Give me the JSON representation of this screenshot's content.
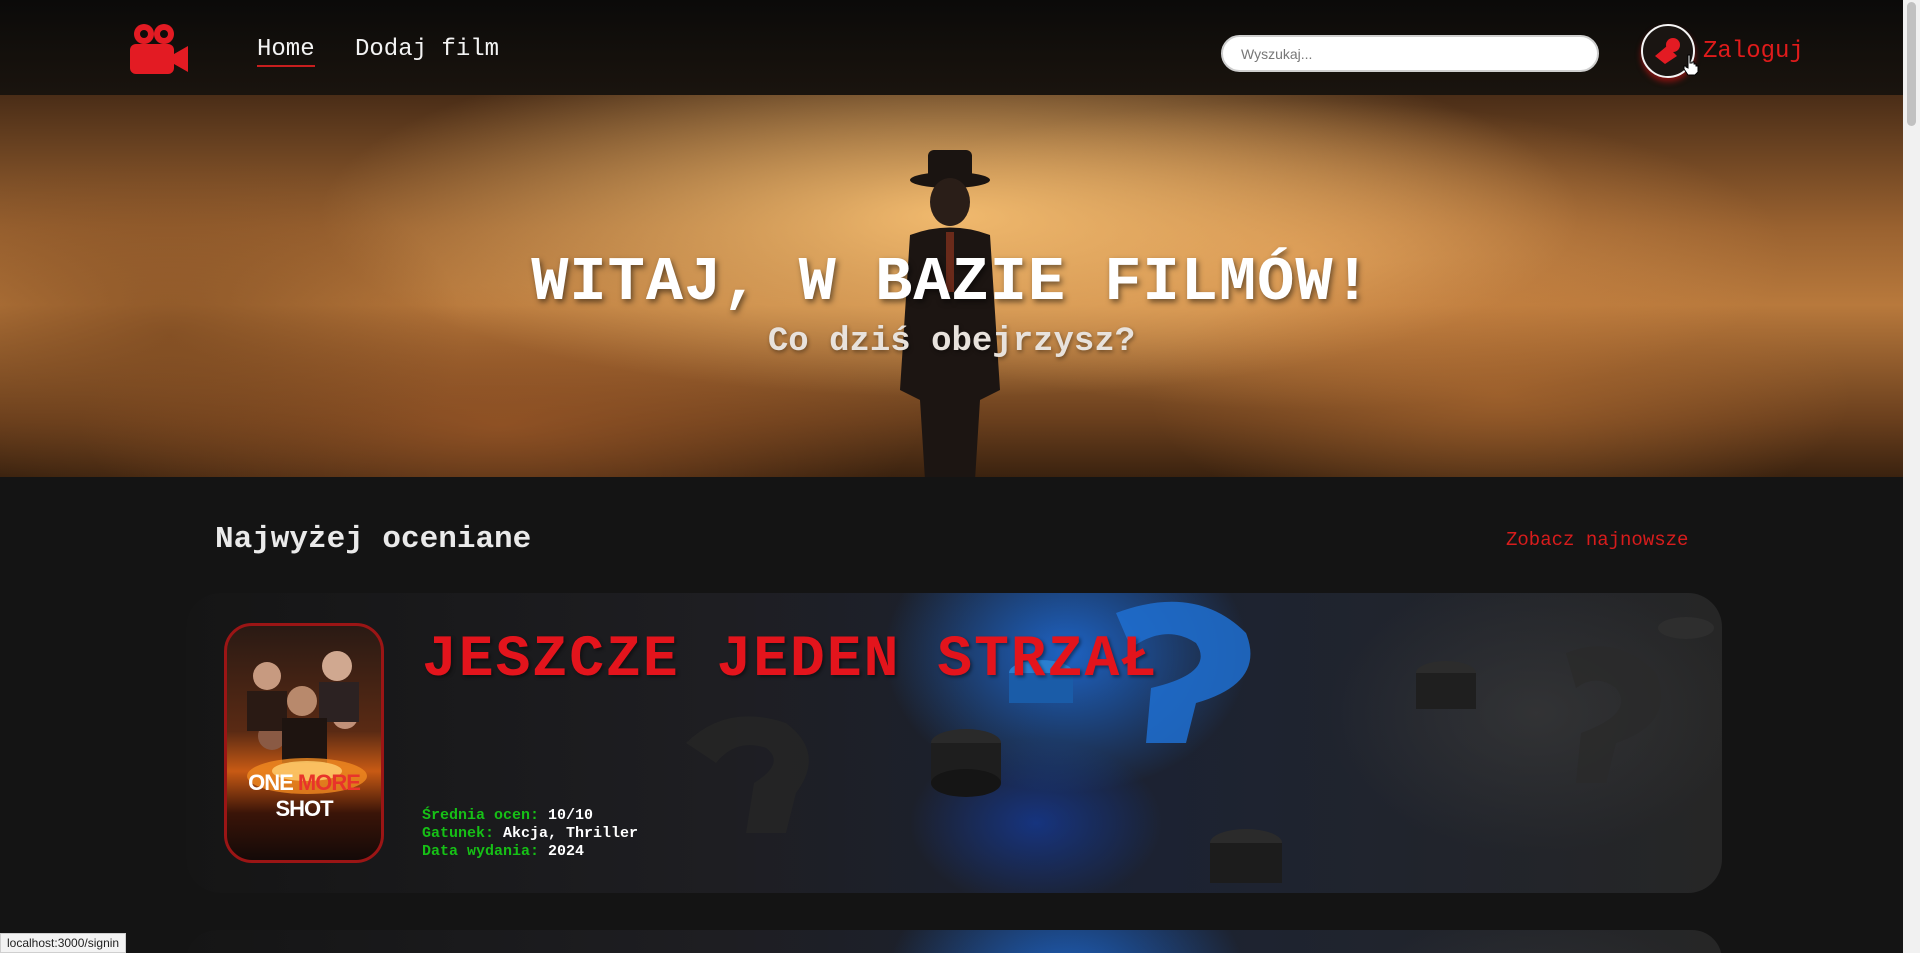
{
  "nav": {
    "logo_icon": "movie-camera-icon",
    "links": [
      {
        "label": "Home"
      },
      {
        "label": "Dodaj film"
      }
    ],
    "search_placeholder": "Wyszukaj...",
    "login_label": "Zaloguj",
    "login_icon": "user-login-icon"
  },
  "hero": {
    "title": "WITAJ, W BAZIE FILMÓW!",
    "subtitle": "Co dziś obejrzysz?"
  },
  "section": {
    "title": "Najwyżej oceniane",
    "link": "Zobacz najnowsze"
  },
  "movies": [
    {
      "title": "JESZCZE JEDEN STRZAŁ",
      "poster_title_a": "ONE ",
      "poster_title_b": "MORE",
      "poster_title_c": " SHOT",
      "rating_label": "Średnia ocen:",
      "rating_value": "10/10",
      "genre_label": "Gatunek:",
      "genre_value": "Akcja, Thriller",
      "date_label": "Data wydania:",
      "date_value": "2024"
    }
  ],
  "status_url": "localhost:3000/signin",
  "colors": {
    "accent": "#e3141c",
    "label_green": "#16c016",
    "background": "#141414"
  }
}
